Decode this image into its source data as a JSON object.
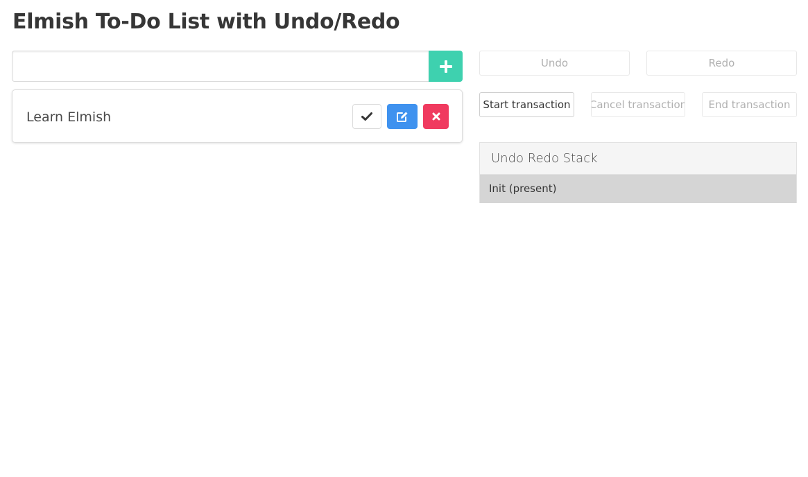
{
  "page": {
    "title": "Elmish To-Do List with Undo/Redo"
  },
  "input": {
    "value": "",
    "placeholder": ""
  },
  "todos": [
    {
      "text": "Learn Elmish",
      "actions": [
        "check-icon",
        "edit-icon",
        "close-icon"
      ]
    }
  ],
  "history": {
    "undo_label": "Undo",
    "redo_label": "Redo",
    "start_label": "Start transaction",
    "cancel_label": "Cancel transaction",
    "end_label": "End transaction"
  },
  "stack": {
    "title": "Undo Redo Stack",
    "items": [
      "Init (present)"
    ]
  },
  "colors": {
    "add": "#3ed1af",
    "edit": "#3f92ef",
    "delete": "#f03a5f",
    "present_item": "#d5d5d5"
  }
}
